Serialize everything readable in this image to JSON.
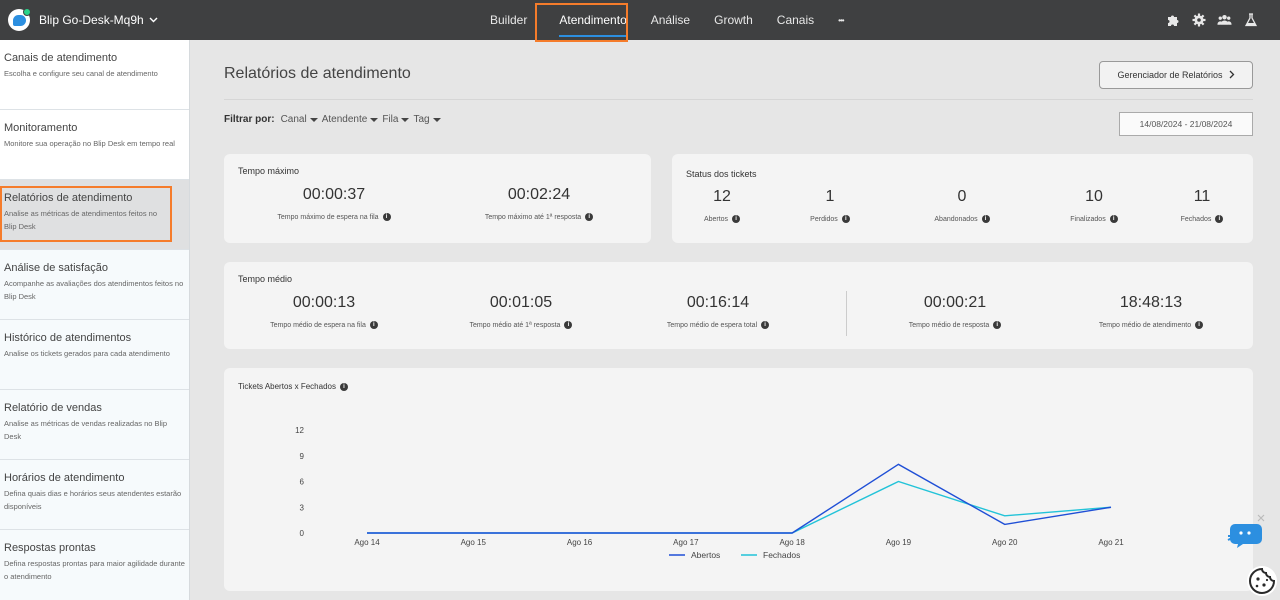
{
  "app": {
    "workspace": "Blip Go-Desk-Mq9h"
  },
  "nav": {
    "items": [
      {
        "id": "builder",
        "label": "Builder"
      },
      {
        "id": "atendimento",
        "label": "Atendimento"
      },
      {
        "id": "analise",
        "label": "Análise"
      },
      {
        "id": "growth",
        "label": "Growth"
      },
      {
        "id": "canais",
        "label": "Canais"
      }
    ],
    "more": "•••",
    "icons": [
      "puzzle-icon",
      "gear-icon",
      "team-icon",
      "flask-icon"
    ]
  },
  "sidebar": {
    "items": [
      {
        "title": "Canais de atendimento",
        "desc": "Escolha e configure seu canal de atendimento"
      },
      {
        "title": "Monitoramento",
        "desc": "Monitore sua operação no Blip Desk em tempo real"
      },
      {
        "title": "Relatórios de atendimento",
        "desc": "Analise as métricas de atendimentos feitos no Blip Desk"
      },
      {
        "title": "Análise de satisfação",
        "desc": "Acompanhe as avaliações dos atendimentos feitos no Blip Desk"
      },
      {
        "title": "Histórico de atendimentos",
        "desc": "Analise os tickets gerados para cada atendimento"
      },
      {
        "title": "Relatório de vendas",
        "desc": "Analise as métricas de vendas realizadas no Blip Desk"
      },
      {
        "title": "Horários de atendimento",
        "desc": "Defina quais dias e horários seus atendentes estarão disponíveis"
      },
      {
        "title": "Respostas prontas",
        "desc": "Defina respostas prontas para maior agilidade durante o atendimento"
      }
    ]
  },
  "page": {
    "title": "Relatórios de atendimento",
    "reports_button": "Gerenciador de Relatórios",
    "filter_label": "Filtrar por:",
    "filters": [
      "Canal",
      "Atendente",
      "Fila",
      "Tag"
    ],
    "date_range": "14/08/2024 - 21/08/2024"
  },
  "tempo_maximo": {
    "title": "Tempo máximo",
    "metrics": [
      {
        "value": "00:00:37",
        "label": "Tempo máximo de espera na fila"
      },
      {
        "value": "00:02:24",
        "label": "Tempo máximo até 1ª resposta"
      }
    ]
  },
  "status_tickets": {
    "title": "Status dos tickets",
    "metrics": [
      {
        "value": "12",
        "label": "Abertos"
      },
      {
        "value": "1",
        "label": "Perdidos"
      },
      {
        "value": "0",
        "label": "Abandonados"
      },
      {
        "value": "10",
        "label": "Finalizados"
      },
      {
        "value": "11",
        "label": "Fechados"
      }
    ]
  },
  "tempo_medio": {
    "title": "Tempo médio",
    "metrics": [
      {
        "value": "00:00:13",
        "label": "Tempo médio de espera na fila"
      },
      {
        "value": "00:01:05",
        "label": "Tempo médio até 1ª resposta"
      },
      {
        "value": "00:16:14",
        "label": "Tempo médio de espera total"
      },
      {
        "value": "00:00:21",
        "label": "Tempo médio de resposta"
      },
      {
        "value": "18:48:13",
        "label": "Tempo médio de atendimento"
      }
    ]
  },
  "chart_data": {
    "type": "line",
    "title": "Tickets Abertos x Fechados",
    "categories": [
      "Ago 14",
      "Ago 15",
      "Ago 16",
      "Ago 17",
      "Ago 18",
      "Ago 19",
      "Ago 20",
      "Ago 21"
    ],
    "yticks": [
      0,
      3,
      6,
      9,
      12
    ],
    "ylim": [
      0,
      12
    ],
    "legend": "bottom",
    "series": [
      {
        "name": "Abertos",
        "color": "#1f4fd6",
        "values": [
          0,
          0,
          0,
          0,
          0,
          8,
          1,
          3
        ]
      },
      {
        "name": "Fechados",
        "color": "#22c3d8",
        "values": [
          0,
          0,
          0,
          0,
          0,
          6,
          2,
          3
        ]
      }
    ]
  }
}
